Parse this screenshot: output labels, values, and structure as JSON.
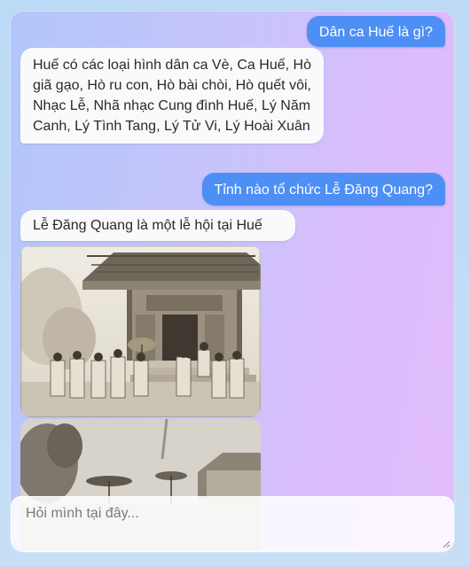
{
  "chat": {
    "messages": [
      {
        "role": "user",
        "text": "Dân ca Huế là gì?"
      },
      {
        "role": "bot",
        "text": "Huế có các loại hình dân ca Vè, Ca Huế, Hò giã gạo, Hò ru con, Hò bài chòi, Hò quết vôi, Nhạc Lễ, Nhã nhạc Cung đình Huế, Lý Năm Canh, Lý Tình Tang, Lý Tử Vi, Lý Hoài Xuân"
      },
      {
        "role": "user",
        "text": "Tỉnh nào tổ chức Lễ Đăng Quang?"
      },
      {
        "role": "bot",
        "text": "Lễ Đăng Quang là một lễ hội tại Huế"
      }
    ],
    "images": [
      {
        "icon": "historical-photo-royal-ceremony"
      },
      {
        "icon": "historical-photo-courtyard-parasols"
      }
    ]
  },
  "input": {
    "placeholder": "Hỏi mình tại đây...",
    "value": ""
  },
  "colors": {
    "user_bubble": "#4e8ff5",
    "bot_bubble": "#fafafd",
    "panel_gradient_start": "#b2c6fb",
    "panel_gradient_end": "#e2bdfb"
  }
}
